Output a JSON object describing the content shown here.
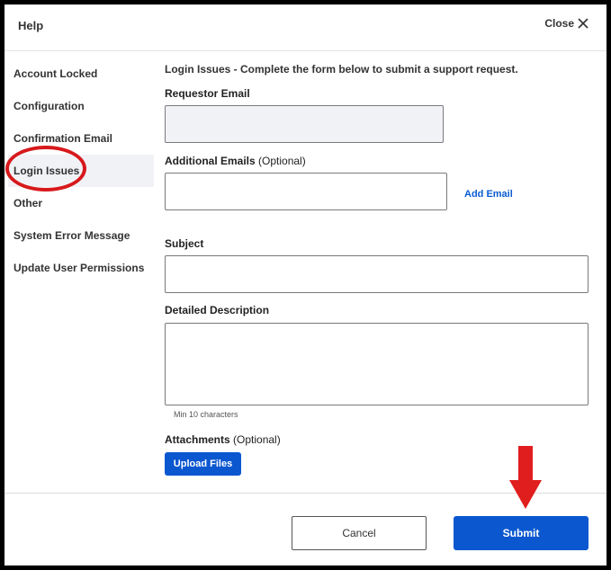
{
  "header": {
    "title": "Help",
    "close_label": "Close"
  },
  "sidebar": {
    "items": [
      {
        "label": "Account Locked",
        "active": false
      },
      {
        "label": "Configuration",
        "active": false
      },
      {
        "label": "Confirmation Email",
        "active": false
      },
      {
        "label": "Login Issues",
        "active": true
      },
      {
        "label": "Other",
        "active": false
      },
      {
        "label": "System Error Message",
        "active": false
      },
      {
        "label": "Update User Permissions",
        "active": false
      }
    ]
  },
  "form": {
    "intro": "Login Issues - Complete the form below to submit a support request.",
    "requestor_email": {
      "label": "Requestor Email",
      "value": ""
    },
    "additional_emails": {
      "label": "Additional Emails",
      "optional": "(Optional)",
      "value": "",
      "add_link": "Add Email"
    },
    "subject": {
      "label": "Subject",
      "value": ""
    },
    "description": {
      "label": "Detailed Description",
      "value": "",
      "hint": "Min 10 characters"
    },
    "attachments": {
      "label": "Attachments",
      "optional": "(Optional)",
      "upload_label": "Upload Files"
    }
  },
  "footer": {
    "cancel_label": "Cancel",
    "submit_label": "Submit"
  },
  "colors": {
    "accent": "#0b57d0",
    "link": "#0a5bd3",
    "annotation": "#d7191c",
    "active_bg": "#f1f2f6"
  },
  "icons": {
    "close": "close-icon",
    "annotation_arrow": "down-arrow-icon"
  }
}
